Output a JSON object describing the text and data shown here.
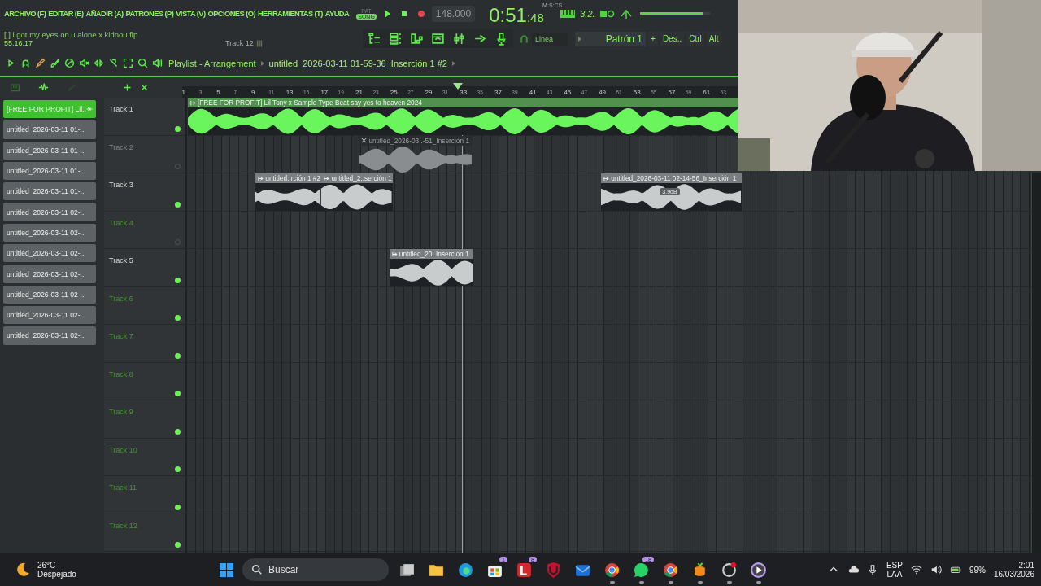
{
  "menu": [
    "ARCHIVO (F)",
    "EDITAR (E)",
    "AÑADIR (A)",
    "PATRONES (P)",
    "VISTA (V)",
    "OPCIONES (O)",
    "HERRAMIENTAS (T)",
    "AYUDA"
  ],
  "transport": {
    "volume": {
      "level": 0.9
    },
    "modes": [
      {
        "label": "PAT",
        "selected": false
      },
      {
        "label": "SONG",
        "selected": true
      }
    ],
    "tempo": "148.000",
    "time": "0:51",
    "time_fraction": ":48",
    "time_unit": "M:S:CS",
    "beat": "3.2."
  },
  "project": {
    "file": "[   ] i got my eyes on u alone x kidnou.flp",
    "duration": "55:16:17",
    "hint": "Track 12"
  },
  "snap": "Linea",
  "pattern": "Patrón 1",
  "pattern_add": "+",
  "modifiers": [
    "Des..",
    "Ctrl",
    "Alt"
  ],
  "playlist": {
    "title": "Playlist - Arrangement",
    "path": "untitled_2026-03-11 01-59-36_Inserción 1 #2",
    "ruler": [
      "1",
      "3",
      "5",
      "7",
      "9",
      "11",
      "13",
      "15",
      "17",
      "19",
      "21",
      "23",
      "25",
      "27",
      "29",
      "31",
      "33",
      "35",
      "37",
      "39",
      "41",
      "43",
      "45",
      "47",
      "49",
      "51",
      "53",
      "55",
      "57",
      "59",
      "61",
      "63"
    ]
  },
  "clip_list": [
    {
      "label": "[FREE FOR PROFIT] Lil..",
      "selected": true
    },
    {
      "label": "untitled_2026-03-11 01-..",
      "selected": false
    },
    {
      "label": "untitled_2026-03-11 01-..",
      "selected": false
    },
    {
      "label": "untitled_2026-03-11 01-..",
      "selected": false
    },
    {
      "label": "untitled_2026-03-11 01-..",
      "selected": false
    },
    {
      "label": "untitled_2026-03-11 02-..",
      "selected": false
    },
    {
      "label": "untitled_2026-03-11 02-..",
      "selected": false
    },
    {
      "label": "untitled_2026-03-11 02-..",
      "selected": false
    },
    {
      "label": "untitled_2026-03-11 02-..",
      "selected": false
    },
    {
      "label": "untitled_2026-03-11 02-..",
      "selected": false
    },
    {
      "label": "untitled_2026-03-11 02-..",
      "selected": false
    },
    {
      "label": "untitled_2026-03-11 02-..",
      "selected": false
    }
  ],
  "tracks": [
    {
      "name": "Track 1",
      "muted": false,
      "empty": false,
      "clips": [
        {
          "label": "[FREE FOR PROFIT] Lil Tony x Sample Type Beat say yes to heaven  2024",
          "color": "#6af55c"
        }
      ]
    },
    {
      "name": "Track 2",
      "muted": true,
      "empty": false,
      "clips": [
        {
          "label": "untitled_2026-03..-51_Inserción 1",
          "color": "#8a8d8f"
        }
      ]
    },
    {
      "name": "Track 3",
      "muted": false,
      "empty": false,
      "clips": [
        {
          "label": "untitled..rción 1 #2",
          "color": "#c9cccc"
        },
        {
          "label": "untitled_2..serción 1",
          "color": "#c9cccc"
        },
        {
          "label": "untitled_2026-03-11 02-14-56_Inserción 1",
          "color": "#c9cccc",
          "tooltip": "3.9dB"
        }
      ]
    },
    {
      "name": "Track 4",
      "muted": true,
      "empty": true
    },
    {
      "name": "Track 5",
      "muted": false,
      "empty": false,
      "clips": [
        {
          "label": "untitled_20..Inserción 1",
          "color": "#c9cccc"
        }
      ]
    },
    {
      "name": "Track 6",
      "muted": false,
      "empty": true
    },
    {
      "name": "Track 7",
      "muted": false,
      "empty": true
    },
    {
      "name": "Track 8",
      "muted": false,
      "empty": true
    },
    {
      "name": "Track 9",
      "muted": false,
      "empty": true
    },
    {
      "name": "Track 10",
      "muted": false,
      "empty": true
    },
    {
      "name": "Track 11",
      "muted": false,
      "empty": true
    },
    {
      "name": "Track 12",
      "muted": false,
      "empty": true
    }
  ],
  "taskbar": {
    "temperature": "26°C",
    "weather": "Despejado",
    "search": {
      "placeholder": "Buscar"
    },
    "apps": [
      {
        "kind": "taskview",
        "running": false
      },
      {
        "kind": "folder",
        "running": false
      },
      {
        "kind": "edge",
        "running": false
      },
      {
        "kind": "store",
        "running": false,
        "badge": "1"
      },
      {
        "kind": "red-l",
        "running": false,
        "badge": "8"
      },
      {
        "kind": "shield",
        "running": false
      },
      {
        "kind": "mail",
        "running": false
      },
      {
        "kind": "chrome",
        "running": true
      },
      {
        "kind": "chat",
        "running": true,
        "badge": "18"
      },
      {
        "kind": "chrome",
        "running": true
      },
      {
        "kind": "fruit",
        "running": true
      },
      {
        "kind": "ring",
        "running": true
      },
      {
        "kind": "player",
        "running": true
      }
    ],
    "lang": "ESP",
    "layout": "LAA",
    "battery": "99%",
    "clock": "2:01",
    "date": "16/03/2026"
  }
}
